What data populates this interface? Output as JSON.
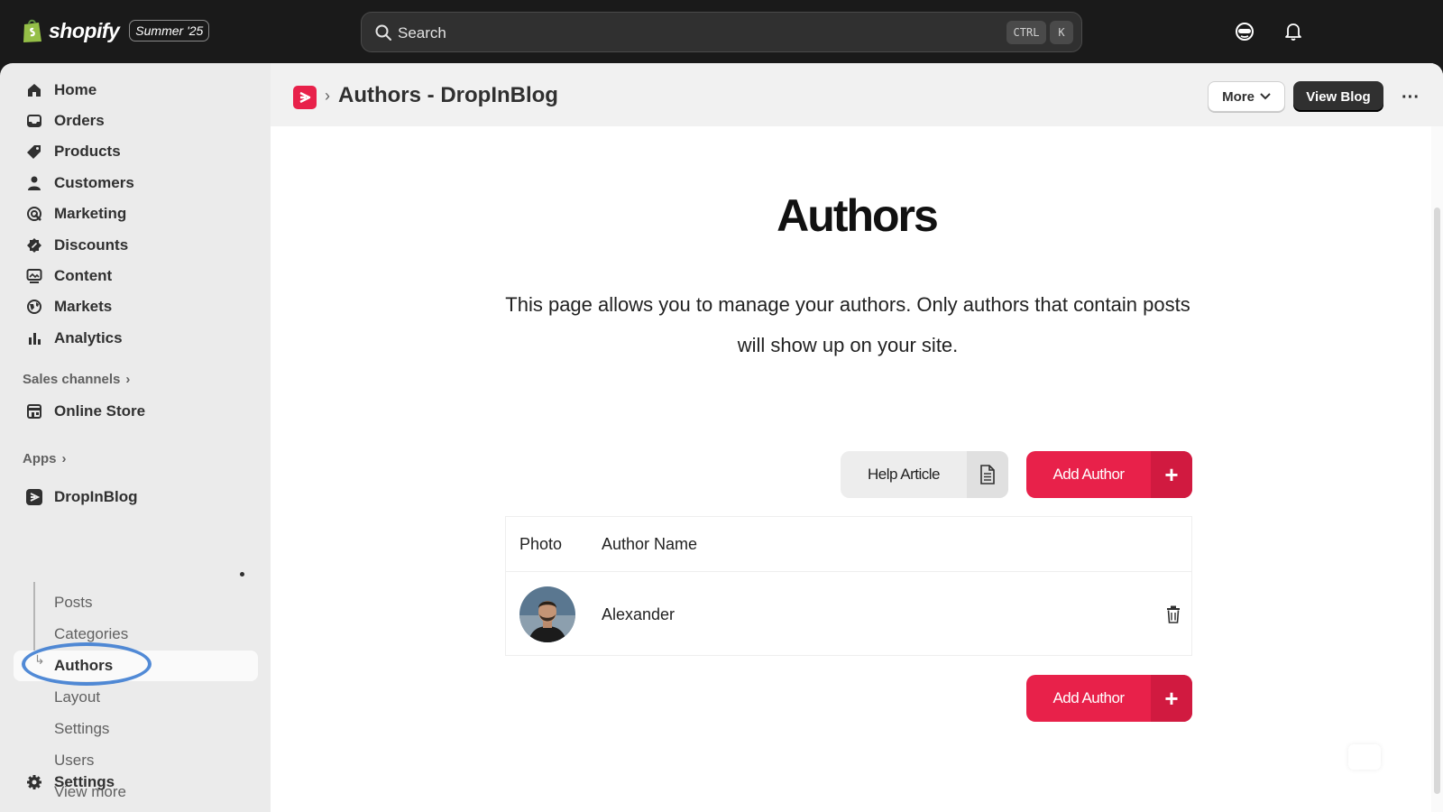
{
  "topbar": {
    "brand": "shopify",
    "edition": "Summer '25",
    "search_placeholder": "Search",
    "shortcut_ctrl": "CTRL",
    "shortcut_k": "K"
  },
  "sidebar": {
    "items": [
      {
        "label": "Home",
        "icon": "home-icon"
      },
      {
        "label": "Orders",
        "icon": "inbox-icon"
      },
      {
        "label": "Products",
        "icon": "tag-icon"
      },
      {
        "label": "Customers",
        "icon": "person-icon"
      },
      {
        "label": "Marketing",
        "icon": "target-icon"
      },
      {
        "label": "Discounts",
        "icon": "discount-icon"
      },
      {
        "label": "Content",
        "icon": "content-icon"
      },
      {
        "label": "Markets",
        "icon": "globe-icon"
      },
      {
        "label": "Analytics",
        "icon": "bar-chart-icon"
      }
    ],
    "sales_channels_label": "Sales channels",
    "online_store": "Online Store",
    "apps_label": "Apps",
    "app_name": "DropInBlog",
    "app_sub_items": [
      "Posts",
      "Categories",
      "Authors",
      "Layout",
      "Settings",
      "Users",
      "View more"
    ],
    "settings": "Settings"
  },
  "header": {
    "title": "Authors - DropInBlog",
    "more_label": "More",
    "view_blog_label": "View Blog"
  },
  "content": {
    "heading": "Authors",
    "description": "This page allows you to manage your authors. Only authors that contain posts will show up on your site.",
    "help_label": "Help Article",
    "add_author_label": "Add Author",
    "table": {
      "columns": [
        "Photo",
        "Author Name"
      ],
      "rows": [
        {
          "name": "Alexander"
        }
      ]
    }
  },
  "colors": {
    "accent": "#e8214a",
    "accent_dark": "#d11a40",
    "topbar": "#1a1a1a",
    "sidebar": "#ebebeb",
    "annotation": "#3e7dd1"
  }
}
